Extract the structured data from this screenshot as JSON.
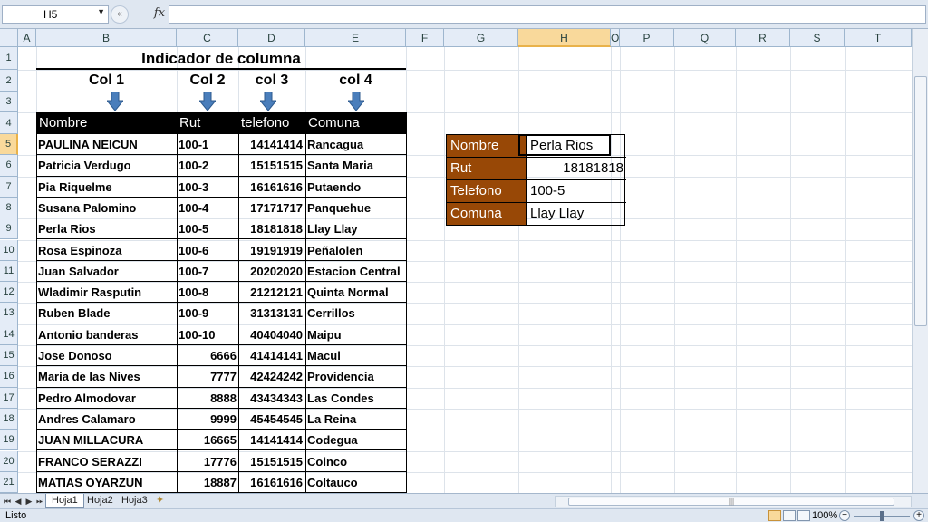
{
  "formula_bar": {
    "name_box": "H5",
    "fx_symbol": "fx",
    "formula": ""
  },
  "columns": [
    "A",
    "B",
    "C",
    "D",
    "E",
    "F",
    "G",
    "H",
    "O",
    "P",
    "Q",
    "R",
    "S",
    "T"
  ],
  "rows": [
    "1",
    "2",
    "3",
    "4",
    "5",
    "6",
    "7",
    "8",
    "9",
    "10",
    "11",
    "12",
    "13",
    "14",
    "15",
    "16",
    "17",
    "18",
    "19",
    "20",
    "21"
  ],
  "sheet": {
    "title": "Indicador de columna",
    "col_indicators": [
      "Col 1",
      "Col 2",
      "col 3",
      "col 4"
    ],
    "headers": [
      "Nombre",
      "Rut",
      "telefono",
      "Comuna"
    ],
    "records": [
      [
        "PAULINA  NEICUN",
        "100-1",
        "14141414",
        "Rancagua"
      ],
      [
        "Patricia Verdugo",
        "100-2",
        "15151515",
        "Santa Maria"
      ],
      [
        "Pia Riquelme",
        "100-3",
        "16161616",
        "Putaendo"
      ],
      [
        "Susana Palomino",
        "100-4",
        "17171717",
        "Panquehue"
      ],
      [
        "Perla Rios",
        "100-5",
        "18181818",
        "Llay Llay"
      ],
      [
        "Rosa Espinoza",
        "100-6",
        "19191919",
        "Peñalolen"
      ],
      [
        "Juan Salvador",
        "100-7",
        "20202020",
        "Estacion Central"
      ],
      [
        "Wladimir Rasputin",
        "100-8",
        "21212121",
        "Quinta Normal"
      ],
      [
        "Ruben Blade",
        "100-9",
        "31313131",
        "Cerrillos"
      ],
      [
        "Antonio banderas",
        "100-10",
        "40404040",
        "Maipu"
      ],
      [
        "Jose Donoso",
        "6666",
        "41414141",
        "Macul"
      ],
      [
        "Maria de las Nives",
        "7777",
        "42424242",
        "Providencia"
      ],
      [
        "Pedro Almodovar",
        "8888",
        "43434343",
        "Las Condes"
      ],
      [
        "Andres Calamaro",
        "9999",
        "45454545",
        "La Reina"
      ],
      [
        "JUAN MILLACURA",
        "16665",
        "14141414",
        "Codegua"
      ],
      [
        "FRANCO  SERAZZI",
        "17776",
        "15151515",
        "Coinco"
      ],
      [
        "MATIAS  OYARZUN",
        "18887",
        "16161616",
        "Coltauco"
      ]
    ],
    "lookup": [
      {
        "label": "Nombre",
        "value": "Perla Rios"
      },
      {
        "label": "Rut",
        "value": "18181818"
      },
      {
        "label": "Telefono",
        "value": "100-5"
      },
      {
        "label": "Comuna",
        "value": "Llay Llay"
      }
    ]
  },
  "tabs": [
    "Hoja1",
    "Hoja2",
    "Hoja3"
  ],
  "status": {
    "ready": "Listo",
    "zoom": "100%"
  },
  "colors": {
    "header_black": "#000000",
    "lookup_brown": "#984806",
    "selection": "#f9d99b",
    "arrow_blue": "#4a7ebb"
  }
}
